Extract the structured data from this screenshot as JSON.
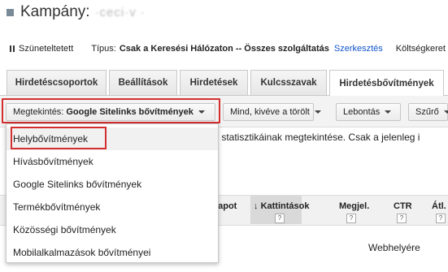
{
  "campaign": {
    "label": "Kampány:",
    "name_obscured": "·ceci·v ·"
  },
  "status_line": {
    "status": "Szüneteltetett",
    "type_label": "Típus:",
    "type_value": "Csak a Keresési Hálózaton -- Összes szolgáltatás",
    "edit_link": "Szerkesztés",
    "budget_label": "Költségkeret"
  },
  "tabs": [
    "Hirdetéscsoportok",
    "Beállítások",
    "Hirdetések",
    "Kulcsszavak",
    "Hirdetésbővítmények"
  ],
  "active_tab": "Hirdetésbővítmények",
  "toolbar": {
    "view_label": "Megtekintés:",
    "view_value": "Google Sitelinks bővítmények",
    "filter_label": "Mind, kivéve a törölt",
    "segment_label": "Lebontás",
    "filter2_label": "Szűrő"
  },
  "menu_items": [
    "Helybővítmények",
    "Hívásbővítmények",
    "Google Sitelinks bővítmények",
    "Termékbővítmények",
    "Közösségi bővítmények",
    "Mobilalkalmazások bővítményei"
  ],
  "highlighted_menu_item": "Helybővítmények",
  "background_text": "k statisztikáinak megtekintése. Csak a jelenleg i",
  "table_headers": {
    "status": "llapot",
    "clicks": "Kattintások",
    "impressions": "Megjel.",
    "ctr": "CTR",
    "avg": "Átl."
  },
  "help_glyph": "?",
  "website_text": "Webhelyére",
  "colors": {
    "highlight": "#d32f2f",
    "link": "#1155cc"
  }
}
